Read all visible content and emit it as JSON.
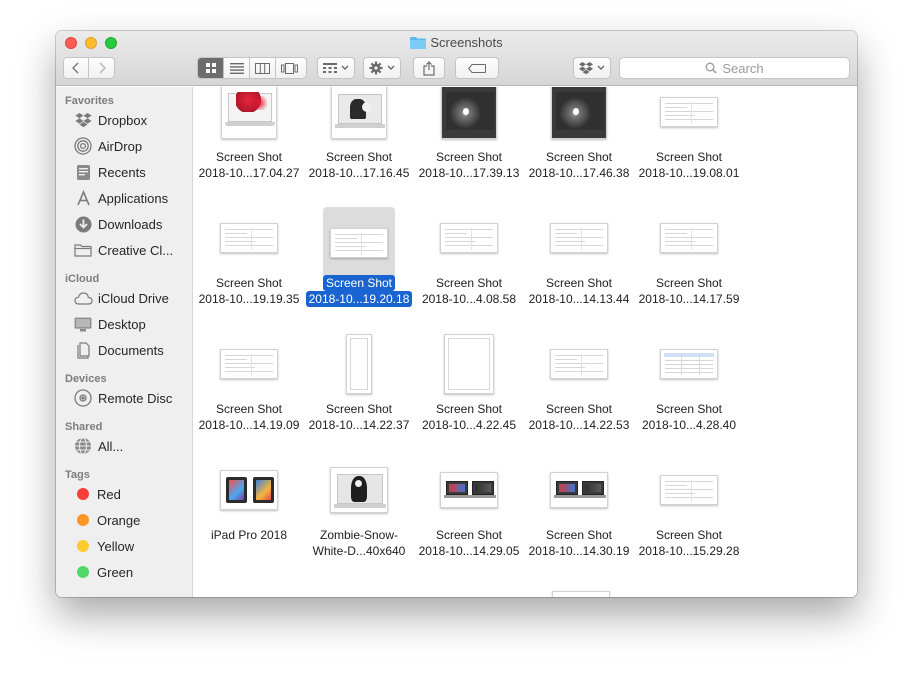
{
  "window": {
    "title": "Screenshots"
  },
  "toolbar": {
    "search_placeholder": "Search",
    "view_modes": [
      "icon-view",
      "list-view",
      "column-view",
      "cover-flow-view"
    ],
    "active_view": "icon-view"
  },
  "sidebar": {
    "sections": [
      {
        "heading": "Favorites",
        "items": [
          {
            "label": "Dropbox",
            "icon": "dropbox-icon"
          },
          {
            "label": "AirDrop",
            "icon": "airdrop-icon"
          },
          {
            "label": "Recents",
            "icon": "recents-icon"
          },
          {
            "label": "Applications",
            "icon": "applications-icon"
          },
          {
            "label": "Downloads",
            "icon": "downloads-icon"
          },
          {
            "label": "Creative Cl...",
            "icon": "folder-icon"
          }
        ]
      },
      {
        "heading": "iCloud",
        "items": [
          {
            "label": "iCloud Drive",
            "icon": "cloud-icon"
          },
          {
            "label": "Desktop",
            "icon": "desktop-icon"
          },
          {
            "label": "Documents",
            "icon": "documents-icon"
          }
        ]
      },
      {
        "heading": "Devices",
        "items": [
          {
            "label": "Remote Disc",
            "icon": "disc-icon"
          }
        ]
      },
      {
        "heading": "Shared",
        "items": [
          {
            "label": "All...",
            "icon": "network-icon"
          }
        ]
      },
      {
        "heading": "Tags",
        "items": [
          {
            "label": "Red",
            "color": "#fc3d39"
          },
          {
            "label": "Orange",
            "color": "#fd9426"
          },
          {
            "label": "Yellow",
            "color": "#fecb2f"
          },
          {
            "label": "Green",
            "color": "#53d769"
          }
        ]
      }
    ]
  },
  "files": [
    {
      "line1": "Screen Shot",
      "line2": "2018-10...17.04.27",
      "thumb": "laptop-red"
    },
    {
      "line1": "Screen Shot",
      "line2": "2018-10...17.16.45",
      "thumb": "laptop-sketch"
    },
    {
      "line1": "Screen Shot",
      "line2": "2018-10...17.39.13",
      "thumb": "laptop-dark"
    },
    {
      "line1": "Screen Shot",
      "line2": "2018-10...17.46.38",
      "thumb": "laptop-dark"
    },
    {
      "line1": "Screen Shot",
      "line2": "2018-10...19.08.01",
      "thumb": "doc-wide"
    },
    {
      "line1": "Screen Shot",
      "line2": "2018-10...19.19.35",
      "thumb": "doc-wide"
    },
    {
      "line1": "Screen Shot",
      "line2": "2018-10...19.20.18",
      "thumb": "doc-wide",
      "selected": true
    },
    {
      "line1": "Screen Shot",
      "line2": "2018-10...4.08.58",
      "thumb": "doc-wide"
    },
    {
      "line1": "Screen Shot",
      "line2": "2018-10...14.13.44",
      "thumb": "doc-wide"
    },
    {
      "line1": "Screen Shot",
      "line2": "2018-10...14.17.59",
      "thumb": "doc-wide"
    },
    {
      "line1": "Screen Shot",
      "line2": "2018-10...14.19.09",
      "thumb": "doc-wide"
    },
    {
      "line1": "Screen Shot",
      "line2": "2018-10...14.22.37",
      "thumb": "doc-tall"
    },
    {
      "line1": "Screen Shot",
      "line2": "2018-10...4.22.45",
      "thumb": "doc-square"
    },
    {
      "line1": "Screen Shot",
      "line2": "2018-10...14.22.53",
      "thumb": "doc-wide"
    },
    {
      "line1": "Screen Shot",
      "line2": "2018-10...4.28.40",
      "thumb": "doc-table"
    },
    {
      "line1": "iPad Pro 2018",
      "line2": "",
      "thumb": "ipad"
    },
    {
      "line1": "Zombie-Snow-",
      "line2": "White-D...40x640",
      "thumb": "laptop-zombie"
    },
    {
      "line1": "Screen Shot",
      "line2": "2018-10...14.29.05",
      "thumb": "laptops-pair"
    },
    {
      "line1": "Screen Shot",
      "line2": "2018-10...14.30.19",
      "thumb": "laptops-pair"
    },
    {
      "line1": "Screen Shot",
      "line2": "2018-10...15.29.28",
      "thumb": "doc-wide"
    }
  ]
}
